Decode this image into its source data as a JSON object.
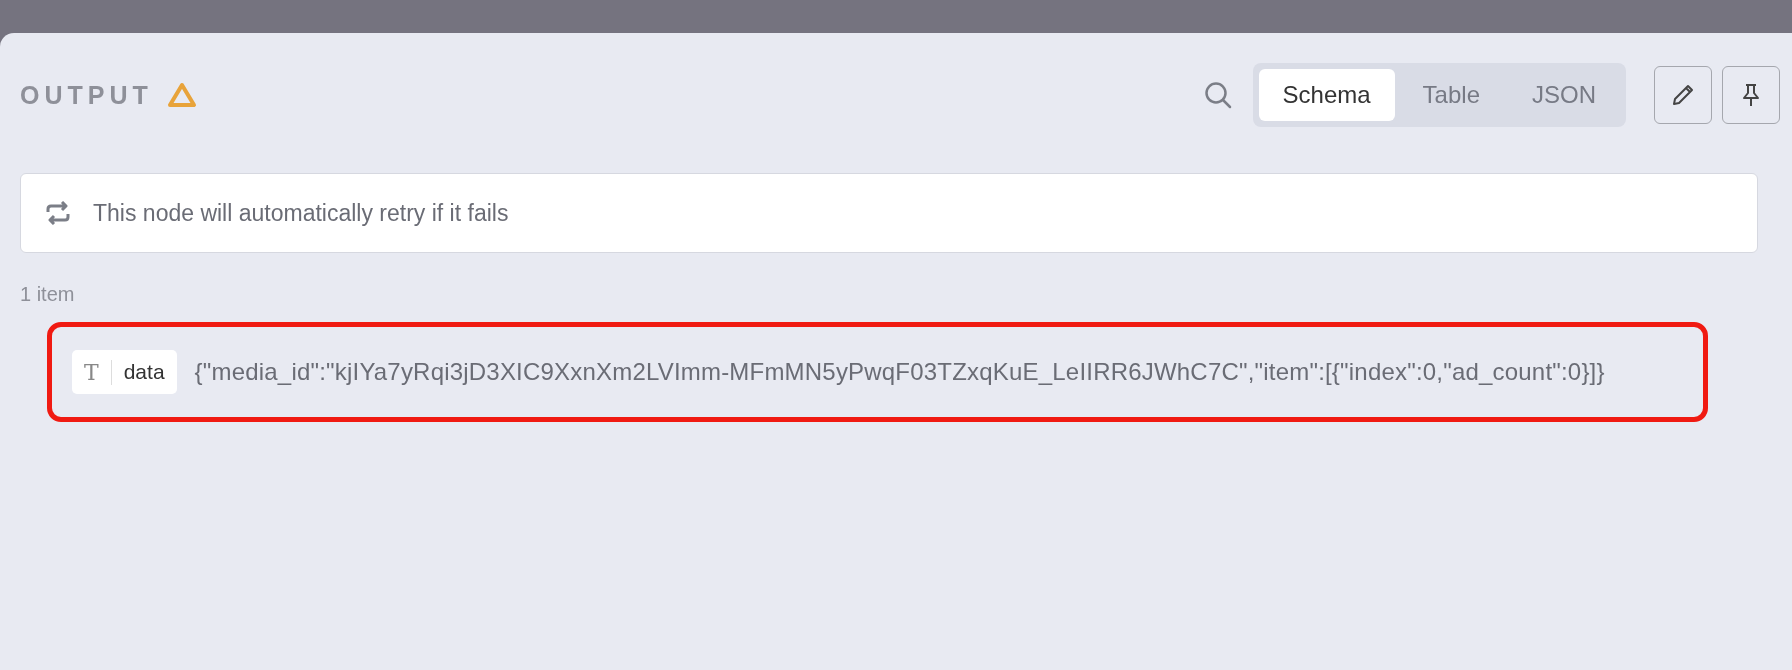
{
  "panel": {
    "title": "OUTPUT",
    "warning": true
  },
  "view_tabs": [
    {
      "label": "Schema",
      "selected": true
    },
    {
      "label": "Table",
      "selected": false
    },
    {
      "label": "JSON",
      "selected": false
    }
  ],
  "notice": {
    "text": "This node will automatically retry if it fails"
  },
  "item_count": "1 item",
  "fields": [
    {
      "type_label": "T",
      "name": "data",
      "value": "{\"media_id\":\"kjIYa7yRqi3jD3XIC9XxnXm2LVImm-MFmMN5yPwqF03TZxqKuE_LeIIRR6JWhC7C\",\"item\":[{\"index\":0,\"ad_count\":0}]}",
      "highlighted": true
    }
  ]
}
